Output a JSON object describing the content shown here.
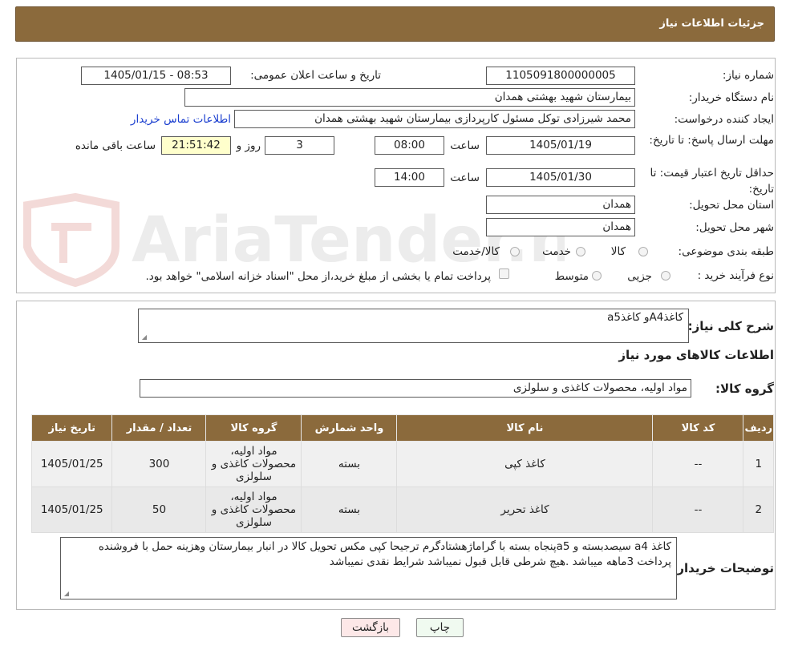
{
  "title": "جزئیات اطلاعات نیاز",
  "need_number": {
    "label": "شماره نیاز:",
    "value": "1105091800000005"
  },
  "announce": {
    "label": "تاریخ و ساعت اعلان عمومی:",
    "value": "1405/01/15 - 08:53"
  },
  "buyer": {
    "label": "نام دستگاه خریدار:",
    "value": "بیمارستان شهید بهشتی همدان"
  },
  "creator": {
    "label": "ایجاد کننده درخواست:",
    "value": "محمد شیرزادی توکل مسئول کارپردازی بیمارستان شهید بهشتی همدان",
    "contact_link": "اطلاعات تماس خریدار"
  },
  "deadline": {
    "label": "مهلت ارسال پاسخ: تا تاریخ:",
    "date": "1405/01/19",
    "time_label": "ساعت",
    "time": "08:00",
    "days": "3",
    "days_label": "روز و",
    "remaining": "21:51:42",
    "remaining_label": "ساعت باقی مانده"
  },
  "validity": {
    "label": "حداقل تاریخ اعتبار قیمت: تا تاریخ:",
    "date": "1405/01/30",
    "time_label": "ساعت",
    "time": "14:00"
  },
  "province": {
    "label": "استان محل تحویل:",
    "value": "همدان"
  },
  "city": {
    "label": "شهر محل تحویل:",
    "value": "همدان"
  },
  "category": {
    "label": "طبقه بندی موضوعی:",
    "options": [
      "کالا",
      "خدمت",
      "کالا/خدمت"
    ]
  },
  "process": {
    "label": "نوع فرآیند خرید :",
    "options": [
      "جزیی",
      "متوسط"
    ],
    "note": "پرداخت تمام یا بخشی از مبلغ خرید،از محل \"اسناد خزانه اسلامی\" خواهد بود."
  },
  "summary": {
    "label": "شرح کلی نیاز:",
    "value": "کاغذA4و کاغذa5"
  },
  "goods_info_title": "اطلاعات کالاهای مورد نیاز",
  "goods_group": {
    "label": "گروه کالا:",
    "value": "مواد اولیه، محصولات کاغذی و سلولزی"
  },
  "table": {
    "headers": [
      "ردیف",
      "کد کالا",
      "نام کالا",
      "واحد شمارش",
      "گروه کالا",
      "تعداد / مقدار",
      "تاریخ نیاز"
    ],
    "rows": [
      [
        "1",
        "--",
        "کاغذ کپی",
        "بسته",
        "مواد اولیه، محصولات کاغذی و سلولزی",
        "300",
        "1405/01/25"
      ],
      [
        "2",
        "--",
        "کاغذ تحریر",
        "بسته",
        "مواد اولیه، محصولات کاغذی و سلولزی",
        "50",
        "1405/01/25"
      ]
    ]
  },
  "notes": {
    "label": "توضیحات خریدار:",
    "value": "کاغذ a4 سیصدبسته و a5پنجاه بسته با گراماژهشتادگرم ترجیحا کپی مکس تحویل کالا در انبار بیمارستان وهزینه حمل با فروشنده پرداخت 3ماهه میباشد .هیچ شرطی قابل قبول نمیباشد شرایط نقدی نمیباشد"
  },
  "buttons": {
    "print": "چاپ",
    "back": "بازگشت"
  },
  "watermark": "AriaTender.neT",
  "colors": {
    "header": "#8b6a3c",
    "link": "#1a3ecf",
    "back_button": "#fde8e8",
    "print_button": "#f0faf0"
  }
}
